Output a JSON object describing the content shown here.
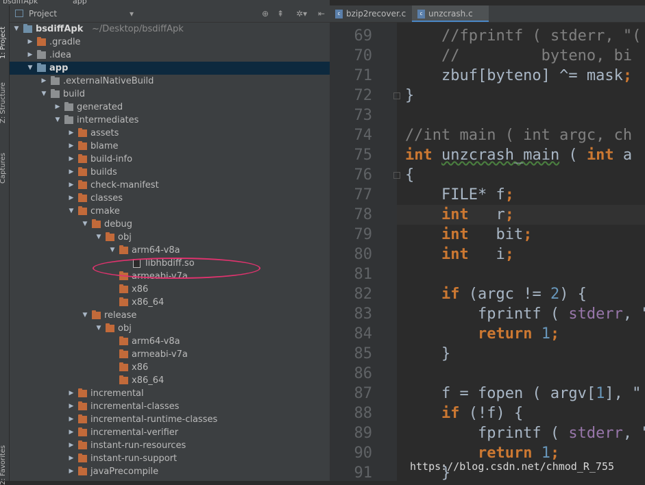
{
  "topbar": {
    "crumb1": "bsdiffApk",
    "crumb2": "app"
  },
  "left_strip": {
    "tab1": "1: Project",
    "tab2": "Z: Structure",
    "tab3": "Captures",
    "tab4": "2: Favorites"
  },
  "project_panel": {
    "title": "Project",
    "dropdown_icon": "chevron-down-icon",
    "header_icons": [
      "target-icon",
      "collapse-icon",
      "gear-icon",
      "hide-icon"
    ]
  },
  "tree": [
    {
      "label": "bsdiffApk",
      "path": "~/Desktop/bsdiffApk",
      "depth": 0,
      "expanded": true,
      "icon": "folder-blue",
      "bold": true
    },
    {
      "label": ".gradle",
      "depth": 1,
      "expanded": false,
      "icon": "folder-orange"
    },
    {
      "label": ".idea",
      "depth": 1,
      "expanded": false,
      "icon": "folder-gray"
    },
    {
      "label": "app",
      "depth": 1,
      "expanded": true,
      "icon": "folder-blue",
      "bold": true,
      "selected": true
    },
    {
      "label": ".externalNativeBuild",
      "depth": 2,
      "expanded": false,
      "icon": "folder-gray"
    },
    {
      "label": "build",
      "depth": 2,
      "expanded": true,
      "icon": "folder-gray"
    },
    {
      "label": "generated",
      "depth": 3,
      "expanded": false,
      "icon": "folder-gray"
    },
    {
      "label": "intermediates",
      "depth": 3,
      "expanded": true,
      "icon": "folder-gray"
    },
    {
      "label": "assets",
      "depth": 4,
      "expanded": false,
      "icon": "folder-orange"
    },
    {
      "label": "blame",
      "depth": 4,
      "expanded": false,
      "icon": "folder-orange"
    },
    {
      "label": "build-info",
      "depth": 4,
      "expanded": false,
      "icon": "folder-orange"
    },
    {
      "label": "builds",
      "depth": 4,
      "expanded": false,
      "icon": "folder-orange"
    },
    {
      "label": "check-manifest",
      "depth": 4,
      "expanded": false,
      "icon": "folder-orange"
    },
    {
      "label": "classes",
      "depth": 4,
      "expanded": false,
      "icon": "folder-orange"
    },
    {
      "label": "cmake",
      "depth": 4,
      "expanded": true,
      "icon": "folder-orange"
    },
    {
      "label": "debug",
      "depth": 5,
      "expanded": true,
      "icon": "folder-orange"
    },
    {
      "label": "obj",
      "depth": 6,
      "expanded": true,
      "icon": "folder-orange"
    },
    {
      "label": "arm64-v8a",
      "depth": 7,
      "expanded": true,
      "icon": "folder-orange"
    },
    {
      "label": "libhbdiff.so",
      "depth": 8,
      "icon": "file"
    },
    {
      "label": "armeabi-v7a",
      "depth": 7,
      "icon": "folder-orange"
    },
    {
      "label": "x86",
      "depth": 7,
      "icon": "folder-orange"
    },
    {
      "label": "x86_64",
      "depth": 7,
      "icon": "folder-orange"
    },
    {
      "label": "release",
      "depth": 5,
      "expanded": true,
      "icon": "folder-orange"
    },
    {
      "label": "obj",
      "depth": 6,
      "expanded": true,
      "icon": "folder-orange"
    },
    {
      "label": "arm64-v8a",
      "depth": 7,
      "icon": "folder-orange"
    },
    {
      "label": "armeabi-v7a",
      "depth": 7,
      "icon": "folder-orange"
    },
    {
      "label": "x86",
      "depth": 7,
      "icon": "folder-orange"
    },
    {
      "label": "x86_64",
      "depth": 7,
      "icon": "folder-orange"
    },
    {
      "label": "incremental",
      "depth": 4,
      "expanded": false,
      "icon": "folder-orange"
    },
    {
      "label": "incremental-classes",
      "depth": 4,
      "expanded": false,
      "icon": "folder-orange"
    },
    {
      "label": "incremental-runtime-classes",
      "depth": 4,
      "expanded": false,
      "icon": "folder-orange"
    },
    {
      "label": "incremental-verifier",
      "depth": 4,
      "expanded": false,
      "icon": "folder-orange"
    },
    {
      "label": "instant-run-resources",
      "depth": 4,
      "expanded": false,
      "icon": "folder-orange"
    },
    {
      "label": "instant-run-support",
      "depth": 4,
      "expanded": false,
      "icon": "folder-orange"
    },
    {
      "label": "javaPrecompile",
      "depth": 4,
      "expanded": false,
      "icon": "folder-orange"
    }
  ],
  "editor_tabs": [
    {
      "label": "bzip2recover.c",
      "active": false
    },
    {
      "label": "unzcrash.c",
      "active": true
    }
  ],
  "code_lines": [
    {
      "n": "69",
      "tokens": [
        {
          "t": "    "
        },
        {
          "t": "//fprintf",
          "c": "cm"
        },
        {
          "t": " ( stderr, \"(",
          "c": "cm"
        }
      ]
    },
    {
      "n": "70",
      "tokens": [
        {
          "t": "    "
        },
        {
          "t": "//         byteno, bi",
          "c": "cm"
        }
      ]
    },
    {
      "n": "71",
      "tokens": [
        {
          "t": "    zbuf[byteno] ^= mask"
        },
        {
          "t": ";",
          "c": "kw"
        }
      ]
    },
    {
      "n": "72",
      "tokens": [
        {
          "t": "}"
        }
      ]
    },
    {
      "n": "73",
      "tokens": []
    },
    {
      "n": "74",
      "tokens": [
        {
          "t": "//int main ( int argc, ch",
          "c": "cm"
        }
      ]
    },
    {
      "n": "75",
      "tokens": [
        {
          "t": "int",
          "c": "kw"
        },
        {
          "t": " "
        },
        {
          "t": "unzcrash_main",
          "c": "squig"
        },
        {
          "t": " ( "
        },
        {
          "t": "int",
          "c": "kw"
        },
        {
          "t": " a"
        }
      ]
    },
    {
      "n": "76",
      "tokens": [
        {
          "t": "{"
        }
      ]
    },
    {
      "n": "77",
      "tokens": [
        {
          "t": "    FILE* f"
        },
        {
          "t": ";",
          "c": "kw"
        }
      ]
    },
    {
      "n": "78",
      "tokens": [
        {
          "t": "    "
        },
        {
          "t": "int",
          "c": "kw"
        },
        {
          "t": "   r"
        },
        {
          "t": ";",
          "c": "kw"
        }
      ],
      "current": true
    },
    {
      "n": "79",
      "tokens": [
        {
          "t": "    "
        },
        {
          "t": "int",
          "c": "kw"
        },
        {
          "t": "   bit"
        },
        {
          "t": ";",
          "c": "kw"
        }
      ]
    },
    {
      "n": "80",
      "tokens": [
        {
          "t": "    "
        },
        {
          "t": "int",
          "c": "kw"
        },
        {
          "t": "   i"
        },
        {
          "t": ";",
          "c": "kw"
        }
      ]
    },
    {
      "n": "81",
      "tokens": []
    },
    {
      "n": "82",
      "tokens": [
        {
          "t": "    "
        },
        {
          "t": "if",
          "c": "kw"
        },
        {
          "t": " (argc != "
        },
        {
          "t": "2",
          "c": "num"
        },
        {
          "t": ") {"
        }
      ]
    },
    {
      "n": "83",
      "tokens": [
        {
          "t": "        fprintf ( "
        },
        {
          "t": "stderr",
          "c": "glb"
        },
        {
          "t": ", \""
        }
      ]
    },
    {
      "n": "84",
      "tokens": [
        {
          "t": "        "
        },
        {
          "t": "return",
          "c": "kw"
        },
        {
          "t": " "
        },
        {
          "t": "1",
          "c": "num"
        },
        {
          "t": ";",
          "c": "kw"
        }
      ]
    },
    {
      "n": "85",
      "tokens": [
        {
          "t": "    }"
        }
      ]
    },
    {
      "n": "86",
      "tokens": []
    },
    {
      "n": "87",
      "tokens": [
        {
          "t": "    f = fopen ( argv["
        },
        {
          "t": "1",
          "c": "num"
        },
        {
          "t": "], \""
        }
      ]
    },
    {
      "n": "88",
      "tokens": [
        {
          "t": "    "
        },
        {
          "t": "if",
          "c": "kw"
        },
        {
          "t": " (!f) {"
        }
      ]
    },
    {
      "n": "89",
      "tokens": [
        {
          "t": "        fprintf ( "
        },
        {
          "t": "stderr",
          "c": "glb"
        },
        {
          "t": ", \""
        }
      ]
    },
    {
      "n": "90",
      "tokens": [
        {
          "t": "        "
        },
        {
          "t": "return",
          "c": "kw"
        },
        {
          "t": " "
        },
        {
          "t": "1",
          "c": "num"
        },
        {
          "t": ";",
          "c": "kw"
        }
      ]
    },
    {
      "n": "91",
      "tokens": [
        {
          "t": "    }"
        }
      ]
    }
  ],
  "watermark": "https://blog.csdn.net/chmod_R_755",
  "colors": {
    "annotation": "#e0336e",
    "selection": "#0d293e",
    "keyword": "#cc7832"
  }
}
